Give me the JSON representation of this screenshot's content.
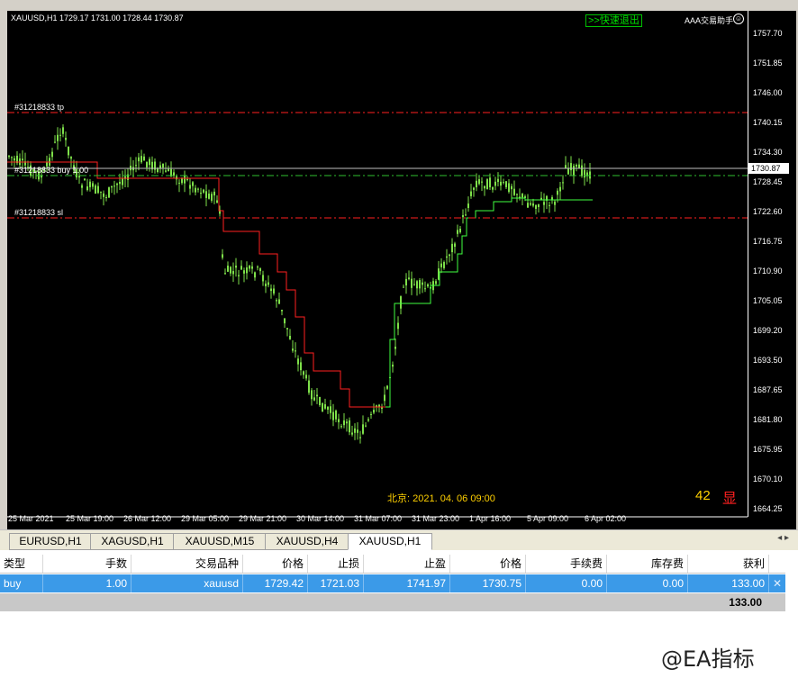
{
  "chart": {
    "symbol_info": "XAUUSD,H1  1729.17 1731.00 1728.44 1730.87",
    "quick_exit": ">>快速退出",
    "assistant": "AAA交易助手",
    "order_tp": "#31218833 tp",
    "order_buy": "#31218833 buy 1.00",
    "order_sl": "#31218833 sl",
    "beijing_time": "北京: 2021. 04. 06  09:00",
    "count": "42",
    "show_label": "显",
    "current_price": "1730.87",
    "colors": {
      "candle": "#7ee04a",
      "line_red": "#ff2020",
      "line_green": "#40ff40",
      "tp_sl": "#ff2020",
      "entry": "#30c030"
    },
    "price_ticks": [
      "1757.70",
      "1751.85",
      "1746.00",
      "1740.15",
      "1734.30",
      "1728.45",
      "1722.60",
      "1716.75",
      "1710.90",
      "1705.05",
      "1699.20",
      "1693.50",
      "1687.65",
      "1681.80",
      "1675.95",
      "1670.10",
      "1664.25"
    ],
    "time_ticks": [
      "25 Mar 2021",
      "25 Mar 19:00",
      "26 Mar 12:00",
      "29 Mar 05:00",
      "29 Mar 21:00",
      "30 Mar 14:00",
      "31 Mar 07:00",
      "31 Mar 23:00",
      "1 Apr 16:00",
      "5 Apr 09:00",
      "6 Apr 02:00"
    ]
  },
  "tabs": [
    "EURUSD,H1",
    "XAGUSD,H1",
    "XAUUSD,M15",
    "XAUUSD,H4",
    "XAUUSD,H1"
  ],
  "terminal": {
    "headers": [
      "类型",
      "手数",
      "交易品种",
      "价格",
      "止损",
      "止盈",
      "价格",
      "手续费",
      "库存费",
      "获利"
    ],
    "order": [
      "buy",
      "1.00",
      "xauusd",
      "1729.42",
      "1721.03",
      "1741.97",
      "1730.75",
      "0.00",
      "0.00",
      "133.00"
    ],
    "total": "133.00"
  },
  "watermark": "@EA指标"
}
